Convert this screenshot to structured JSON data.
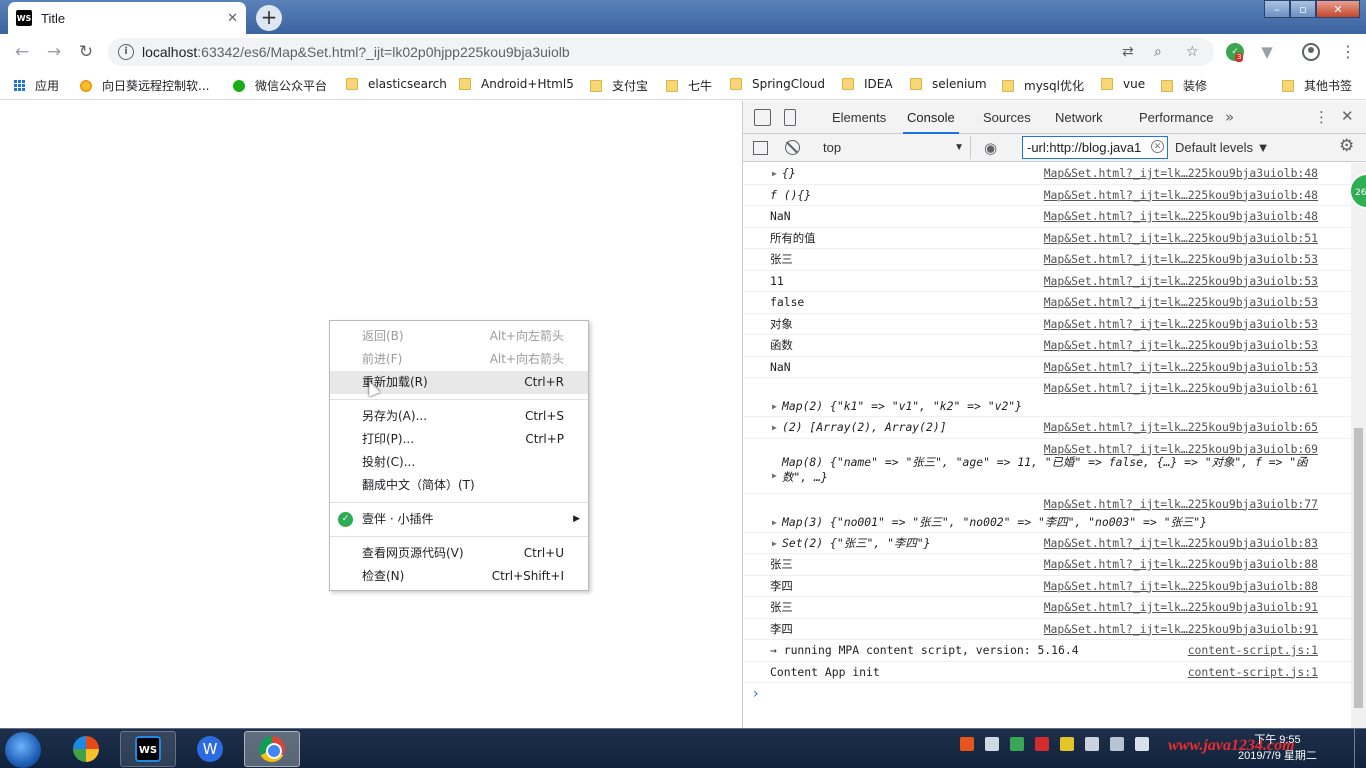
{
  "browser": {
    "tab_title": "Title",
    "tab_favicon": "WS",
    "close_glyph": "✕",
    "newtab_glyph": "+",
    "url_host": "localhost",
    "url_rest": ":63342/es6/Map&Set.html?_ijt=lk02p0hjpp225kou9bja3uiolb",
    "ext_badge": "3"
  },
  "bookmarks": [
    {
      "label": "应用",
      "icon": "apps-icon"
    },
    {
      "label": "向日葵远程控制软...",
      "icon": "sunflower-icon"
    },
    {
      "label": "微信公众平台",
      "icon": "wechat-icon"
    },
    {
      "label": "elasticsearch",
      "icon": "folder-icon"
    },
    {
      "label": "Android+Html5",
      "icon": "folder-icon"
    },
    {
      "label": "支付宝",
      "icon": "folder-icon"
    },
    {
      "label": "七牛",
      "icon": "folder-icon"
    },
    {
      "label": "SpringCloud",
      "icon": "folder-icon"
    },
    {
      "label": "IDEA",
      "icon": "folder-icon"
    },
    {
      "label": "selenium",
      "icon": "folder-icon"
    },
    {
      "label": "mysql优化",
      "icon": "folder-icon"
    },
    {
      "label": "vue",
      "icon": "folder-icon"
    },
    {
      "label": "装修",
      "icon": "folder-icon"
    },
    {
      "label": "其他书签",
      "icon": "folder-icon"
    }
  ],
  "context_menu": {
    "items": [
      {
        "label": "返回(B)",
        "shortcut": "Alt+向左箭头"
      },
      {
        "label": "前进(F)",
        "shortcut": "Alt+向右箭头"
      },
      {
        "label": "重新加载(R)",
        "shortcut": "Ctrl+R"
      },
      {
        "label": "另存为(A)...",
        "shortcut": "Ctrl+S"
      },
      {
        "label": "打印(P)...",
        "shortcut": "Ctrl+P"
      },
      {
        "label": "投射(C)..."
      },
      {
        "label": "翻成中文（简体）(T)"
      },
      {
        "label": "壹伴 · 小插件"
      },
      {
        "label": "查看网页源代码(V)",
        "shortcut": "Ctrl+U"
      },
      {
        "label": "检查(N)",
        "shortcut": "Ctrl+Shift+I"
      }
    ]
  },
  "devtools": {
    "tabs": [
      "Elements",
      "Console",
      "Sources",
      "Network",
      "Performance"
    ],
    "active_tab": "Console",
    "more_glyph": "»",
    "context": "top",
    "filter_value": "-url:http://blog.java1",
    "levels": "Default levels",
    "console": {
      "src48": "Map&Set.html?_ijt=lk…225kou9bja3uiolb:48",
      "src51": "Map&Set.html?_ijt=lk…225kou9bja3uiolb:51",
      "src53": "Map&Set.html?_ijt=lk…225kou9bja3uiolb:53",
      "src61": "Map&Set.html?_ijt=lk…225kou9bja3uiolb:61",
      "src65": "Map&Set.html?_ijt=lk…225kou9bja3uiolb:65",
      "src69": "Map&Set.html?_ijt=lk…225kou9bja3uiolb:69",
      "src77": "Map&Set.html?_ijt=lk…225kou9bja3uiolb:77",
      "src83": "Map&Set.html?_ijt=lk…225kou9bja3uiolb:83",
      "src88": "Map&Set.html?_ijt=lk…225kou9bja3uiolb:88",
      "src91": "Map&Set.html?_ijt=lk…225kou9bja3uiolb:91",
      "src_cs": "content-script.js:1",
      "l_obj": "{}",
      "l_fn": "f (){}",
      "l_nan": "NaN",
      "l_allvals": "所有的值",
      "l_zs": "张三",
      "l_11": "11",
      "l_false": "false",
      "l_obj_cn": "对象",
      "l_fn_cn": "函数",
      "l_nan2": "NaN",
      "l_map2": "Map(2) {\"k1\" => \"v1\", \"k2\" => \"v2\"}",
      "l_arr": "(2) [Array(2), Array(2)]",
      "l_map8": "Map(8) {\"name\" => \"张三\", \"age\" => 11, \"已婚\" => false, {…} => \"对象\", f => \"函数\", …}",
      "l_map3": "Map(3) {\"no001\" => \"张三\", \"no002\" => \"李四\", \"no003\" => \"张三\"}",
      "l_set2": "Set(2) {\"张三\", \"李四\"}",
      "l_zs2": "张三",
      "l_ls": "李四",
      "l_zs3": "张三",
      "l_ls2": "李四",
      "l_mpa": "→ running MPA content script, version: 5.16.4",
      "l_cai": "Content App init"
    },
    "side_badge": "26"
  },
  "taskbar": {
    "clock_time": "下午 9:55",
    "clock_date": "2019/7/9 星期二",
    "watermark": "www.java1234.com"
  },
  "colors": {
    "accent": "#1a73e8",
    "console_string": "#c41a16",
    "console_number": "#1c00cf"
  }
}
